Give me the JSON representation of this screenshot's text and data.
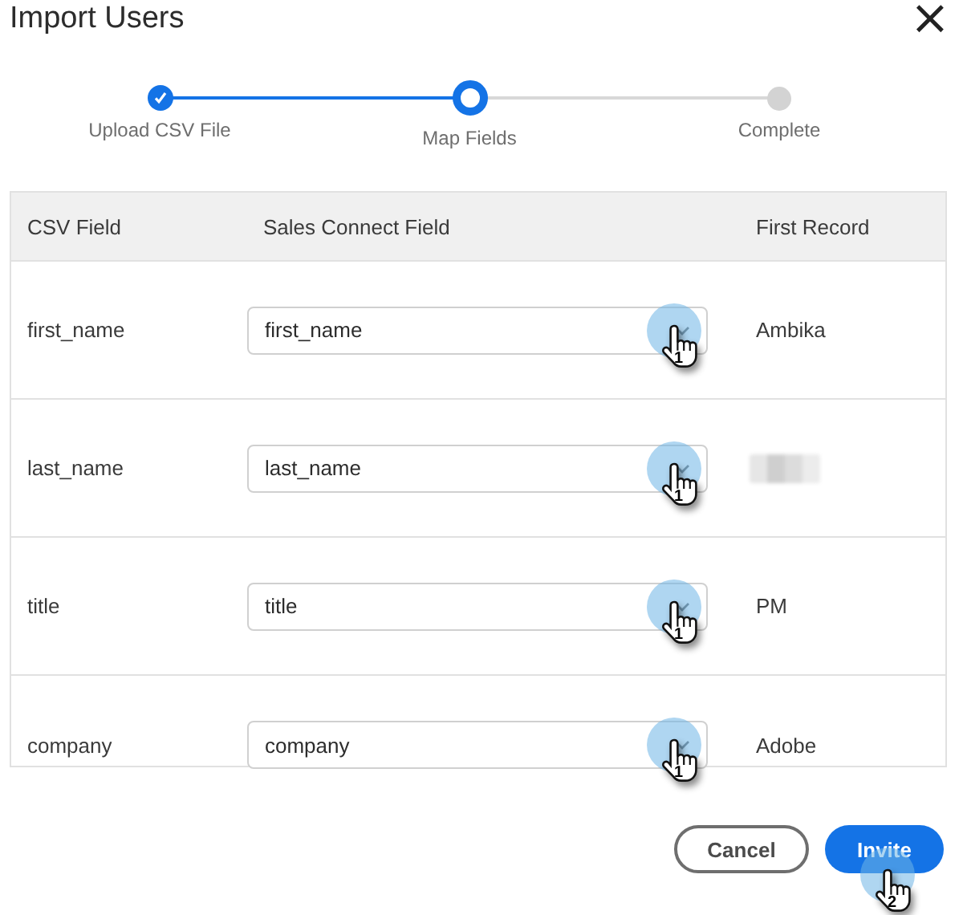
{
  "dialog": {
    "title": "Import Users",
    "close": "×"
  },
  "steps": [
    {
      "label": "Upload CSV File",
      "completed": true,
      "selected": false
    },
    {
      "label": "Map Fields",
      "completed": false,
      "selected": true
    },
    {
      "label": "Complete",
      "completed": false,
      "selected": false
    }
  ],
  "table": {
    "columns": [
      "CSV Field",
      "Sales Connect Field",
      "First Record"
    ],
    "rows": [
      {
        "csv_field": "first_name",
        "mapped_field": "first_name",
        "first_record": "Ambika",
        "callout": "1"
      },
      {
        "csv_field": "last_name",
        "mapped_field": "last_name",
        "first_record_redacted": true,
        "callout": "1"
      },
      {
        "csv_field": "title",
        "mapped_field": "title",
        "first_record": "PM",
        "callout": "1"
      },
      {
        "csv_field": "company",
        "mapped_field": "company",
        "first_record": "Adobe",
        "callout": "1"
      }
    ]
  },
  "buttons": [
    {
      "label": "Cancel",
      "kind": "secondary"
    },
    {
      "label": "Invite",
      "kind": "primary",
      "callout": "2"
    }
  ]
}
